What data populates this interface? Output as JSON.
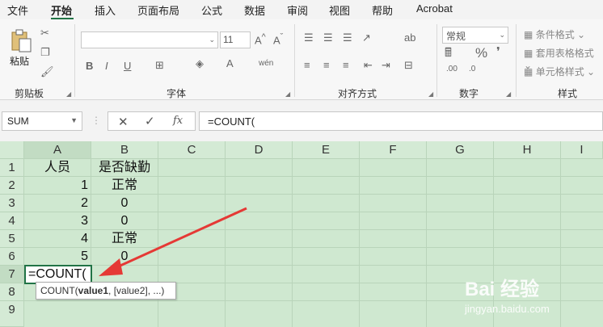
{
  "menu": [
    "文件",
    "开始",
    "插入",
    "页面布局",
    "公式",
    "数据",
    "审阅",
    "视图",
    "帮助",
    "Acrobat"
  ],
  "ribbon": {
    "clipboard": {
      "label": "剪贴板",
      "paste_label": "粘贴"
    },
    "font": {
      "label": "字体",
      "size": "11"
    },
    "alignment": {
      "label": "对齐方式"
    },
    "number": {
      "label": "数字",
      "format": "常规"
    },
    "styles": {
      "label": "样式",
      "items": [
        "条件格式",
        "套用表格格式",
        "单元格样式"
      ]
    }
  },
  "formula_bar": {
    "name_box": "SUM",
    "fx": "fx",
    "formula": "=COUNT("
  },
  "columns": [
    "A",
    "B",
    "C",
    "D",
    "E",
    "F",
    "G",
    "H",
    "I"
  ],
  "rows": [
    "1",
    "2",
    "3",
    "4",
    "5",
    "6",
    "7",
    "8",
    "9"
  ],
  "cells": {
    "A1": "人员",
    "B1": "是否缺勤",
    "A2": "1",
    "B2": "正常",
    "A3": "2",
    "B3": "0",
    "A4": "3",
    "B4": "0",
    "A5": "4",
    "B5": "正常",
    "A6": "5",
    "B6": "0",
    "A7": "=COUNT("
  },
  "tooltip": {
    "func": "COUNT(",
    "arg1": "value1",
    "rest": ", [value2], ...)"
  },
  "watermark": {
    "brand": "Bai 经验",
    "url": "jingyan.baidu.com"
  },
  "colors": {
    "accent": "#217346",
    "grid_bg": "#cfe8d0",
    "arrow": "#e53935"
  }
}
